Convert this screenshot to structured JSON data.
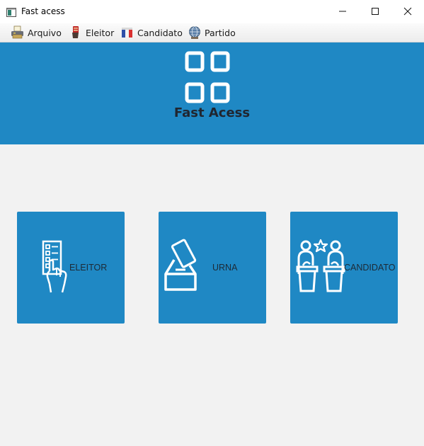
{
  "window": {
    "title": "Fast acess"
  },
  "menu": {
    "items": [
      {
        "label": "Arquivo",
        "icon": "printer-icon"
      },
      {
        "label": "Eleitor",
        "icon": "hand-voting-icon"
      },
      {
        "label": "Candidato",
        "icon": "flag-icon"
      },
      {
        "label": "Partido",
        "icon": "globe-icon"
      }
    ]
  },
  "header": {
    "title": "Fast Acess",
    "icon": "grid-icon"
  },
  "cards": [
    {
      "label": "ELEITOR",
      "icon": "ballot-hand-icon"
    },
    {
      "label": "URNA",
      "icon": "ballot-box-icon"
    },
    {
      "label": "CANDIDATO",
      "icon": "candidates-podium-icon"
    }
  ],
  "colors": {
    "accent": "#1f88c4",
    "background": "#f2f2f2",
    "card_text": "#1d2a36"
  }
}
